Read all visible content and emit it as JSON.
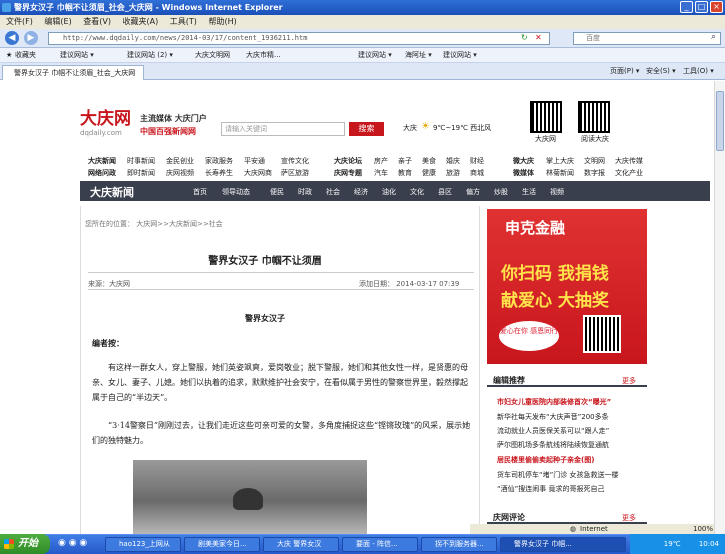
{
  "window": {
    "title": "警界女汉子 巾帼不让须眉_社会_大庆网 - Windows Internet Explorer",
    "menu": [
      "文件(F)",
      "编辑(E)",
      "查看(V)",
      "收藏夹(A)",
      "工具(T)",
      "帮助(H)"
    ]
  },
  "nav": {
    "url": "http://www.dqdaily.com/news/2014-03/17/content_1936211.htm",
    "search_placeholder": "百度"
  },
  "favorites": {
    "label": "收藏夹",
    "items": [
      "建议网站 ▾",
      "建议网站 (2) ▾",
      "大庆文明网",
      "大庆市精...",
      "建议网站 ▾",
      "海阿址 ▾",
      "建议网站 ▾"
    ]
  },
  "tab": {
    "title": "警界女汉子 巾帼不让须眉_社会_大庆网"
  },
  "tools": {
    "page": "页面(P) ▾",
    "safety": "安全(S) ▾",
    "tools": "工具(O) ▾"
  },
  "site": {
    "logo_cn": "大庆网",
    "logo_domain": "dqdaily.com",
    "slogan_top": "主流媒体 大庆门户",
    "slogan_bottom": "中国百强新闻网",
    "search_placeholder": "请输入关键词",
    "search_button": "搜索",
    "city": "大庆",
    "weather": "9℃~19℃ 西北风",
    "qr1_label": "大庆网",
    "qr2_label": "阅读大庆",
    "nav_row1": [
      "大庆新闻",
      "时事新闻",
      "金民创业",
      "家政服务",
      "平安通",
      "宣传文化",
      "大庆论坛",
      "房产",
      "亲子",
      "美食",
      "婚庆",
      "财经",
      "微大庆",
      "掌上大庆",
      "文明网",
      "大庆传媒"
    ],
    "nav_row2": [
      "网络问政",
      "即时新闻",
      "庆网视频",
      "长寿养生",
      "大庆网商",
      "萨区旅游",
      "庆网专题",
      "汽车",
      "教育",
      "健康",
      "旅游",
      "商城",
      "微媒体",
      "林菊新闻",
      "数字报",
      "文化产业"
    ]
  },
  "section": {
    "title": "大庆新闻",
    "links": [
      "首页",
      "领导动态",
      "便民",
      "时政",
      "社会",
      "经济",
      "油化",
      "文化",
      "县区",
      "偏方",
      "炒股",
      "生活",
      "视频"
    ]
  },
  "article": {
    "breadcrumb": "您所在的位置：  大庆网>>大庆新闻>>社会",
    "title": "警界女汉子 巾帼不让须眉",
    "source": "来源：大庆网",
    "date": "添加日期：  2014-03-17  07:39",
    "subtitle": "警界女汉子",
    "editor_label": "编者按：",
    "p1": "有这样一群女人，穿上警服，她们英姿飒爽，爱岗敬业；脱下警服，她们和其他女性一样，",
    "p2": "是贤惠的母亲、女儿、妻子、儿媳。她们以执着的追求，默默维护社会安宁，在看似属于男性的警察世界里，",
    "p3": "毅然撑起属于自己的“半边天”。",
    "p4": "“3·14警察日”刚刚过去，让我们走近这些可亲可爱的女警，多角度捕捉这些“铿锵玫瑰”的风采，展示她们的独特魅力。"
  },
  "ad": {
    "brand": "申克金融",
    "line1": "你扫码 我捐钱",
    "line2": "献爱心 大抽奖",
    "badge": "爱心在你 感恩同行"
  },
  "sidebar": {
    "recommend_title": "编辑推荐",
    "more": "更多",
    "items": [
      "市妇女儿童医院内部装修首次“曝光”",
      "新华社每天发布“大庆声音”200多条",
      "流动就业人员医保关系可以“跟人走”",
      "萨尔图机场多条航线将陆续恢复通航",
      "居民楼里偷偷卖起种子亲金(图)",
      "货车司机停车“堵”门诊 女孩急救送一楼",
      "“酒仙”搜连闹事 竟求的哥报死自己"
    ],
    "comment_title": "庆网评论",
    "comment_more": "更多"
  },
  "status": {
    "zone": "Internet",
    "zoom": "100%"
  },
  "taskbar": {
    "start": "开始",
    "tasks": [
      "hao123_上网从",
      "剧美美家今日...",
      "大庆 警界女汉",
      "要面 - 阵信...",
      "拐不到服务器...",
      "警界女汉子 巾帼..."
    ],
    "tray_temp": "19℃",
    "time": "10:04"
  },
  "colors": {
    "brand_red": "#c8161d",
    "section_bar": "#3a3f4d",
    "xp_blue": "#2559c9"
  }
}
